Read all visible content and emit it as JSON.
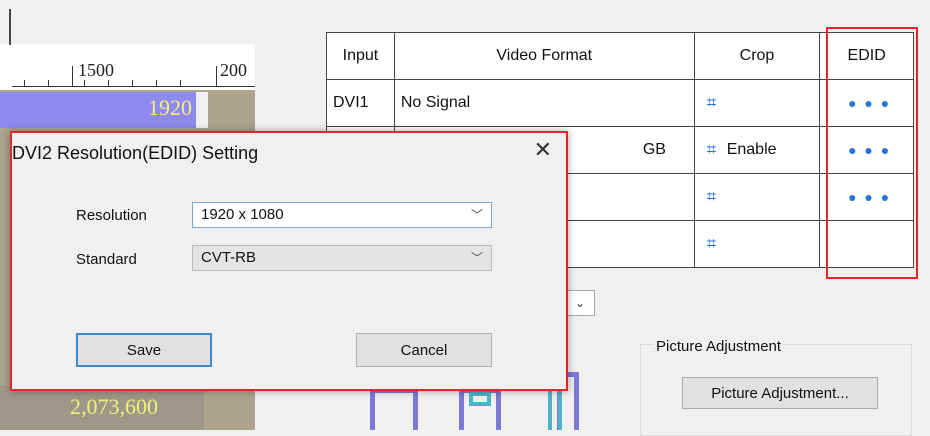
{
  "canvas": {
    "ruler_labels": [
      "1500",
      "200"
    ],
    "block_label": "1920",
    "bottom_label": "2,073,600"
  },
  "table": {
    "headers": [
      "Input",
      "Video Format",
      "Crop",
      "EDID"
    ],
    "rows": [
      {
        "input": "DVI1",
        "format": "No Signal",
        "crop_text": "",
        "has_edid": true
      },
      {
        "input": "",
        "format": "GB",
        "crop_text": "Enable",
        "has_edid": true
      },
      {
        "input": "",
        "format": "",
        "crop_text": "",
        "has_edid": true
      },
      {
        "input": "",
        "format": "",
        "crop_text": "",
        "has_edid": false
      }
    ],
    "crop_icon": "crop-icon",
    "edid_icon": "more-dots-icon",
    "edid_glyph": "● ● ●",
    "highlight_color": "#e2252e"
  },
  "picture_adjustment": {
    "group_title": "Picture Adjustment",
    "button_label": "Picture Adjustment..."
  },
  "dialog": {
    "title": "DVI2 Resolution(EDID) Setting",
    "close_glyph": "✕",
    "resolution_label": "Resolution",
    "resolution_value": "1920 x 1080",
    "standard_label": "Standard",
    "standard_value": "CVT-RB",
    "save_label": "Save",
    "cancel_label": "Cancel"
  }
}
